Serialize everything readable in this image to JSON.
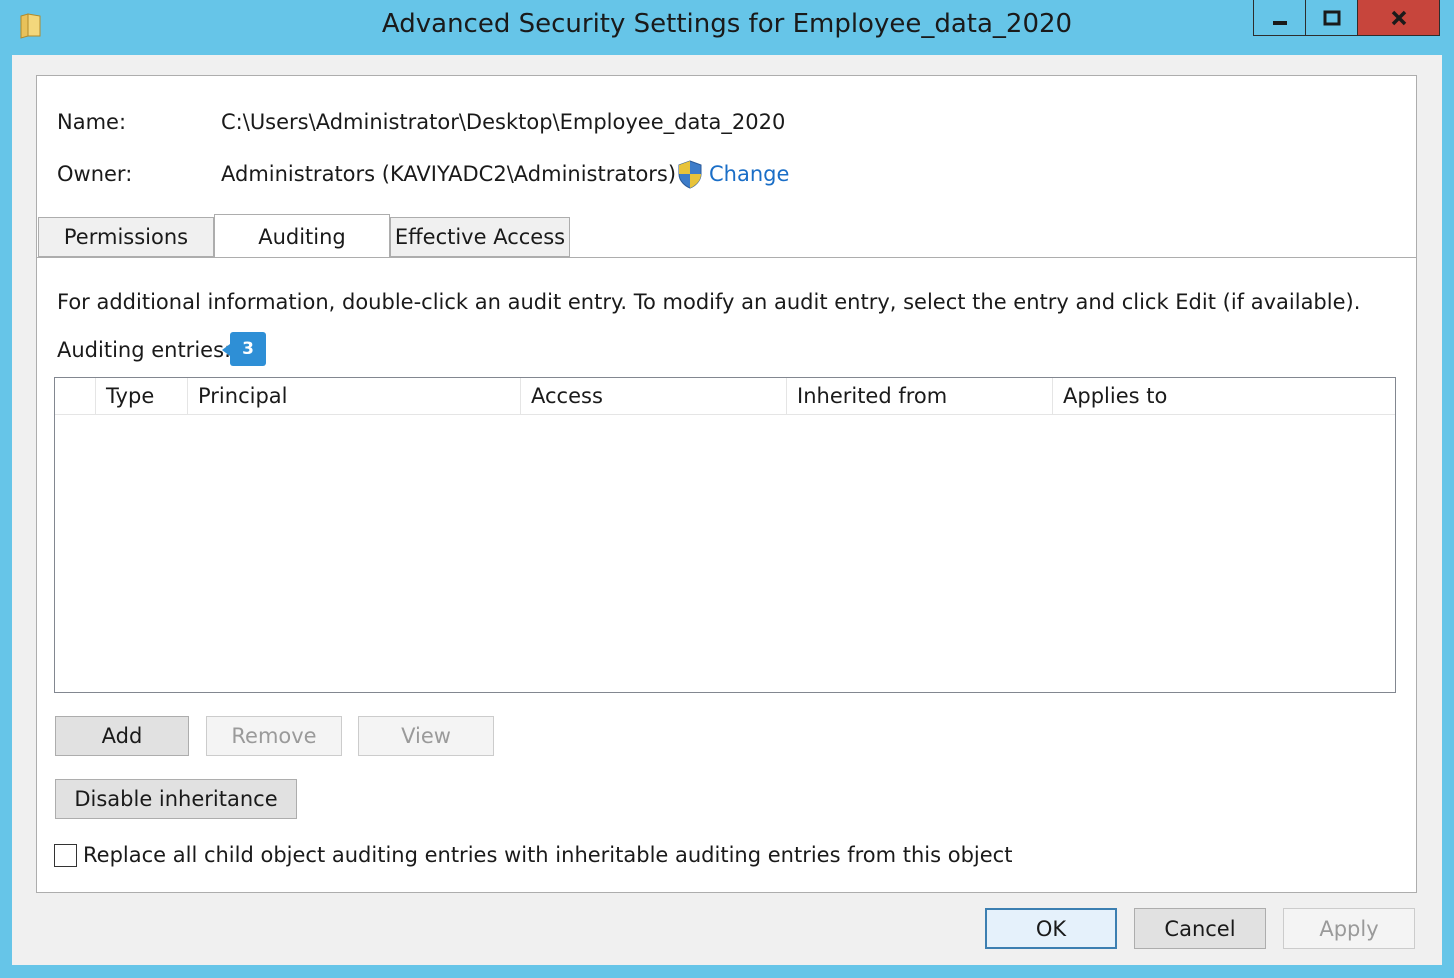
{
  "window": {
    "title": "Advanced Security Settings for Employee_data_2020",
    "minimize_glyph": "▁",
    "maximize_glyph": "□",
    "close_glyph": "✕",
    "accent_color": "#66c5e8",
    "close_color": "#c7453c"
  },
  "info": {
    "name_label": "Name:",
    "name_value": "C:\\Users\\Administrator\\Desktop\\Employee_data_2020",
    "owner_label": "Owner:",
    "owner_value": "Administrators (KAVIYADC2\\Administrators)",
    "change_link": "Change",
    "link_color": "#1a6ec7"
  },
  "tabs": [
    {
      "label": "Permissions",
      "active": false
    },
    {
      "label": "Auditing",
      "active": true
    },
    {
      "label": "Effective Access",
      "active": false
    }
  ],
  "auditing": {
    "instructions": "For additional information, double-click an audit entry. To modify an audit entry, select the entry and click Edit (if available).",
    "entries_label": "Auditing entries:",
    "callout_number": "3",
    "columns": [
      "Type",
      "Principal",
      "Access",
      "Inherited from",
      "Applies to"
    ],
    "rows": []
  },
  "buttons": {
    "add": "Add",
    "remove": "Remove",
    "view": "View",
    "disable_inheritance": "Disable inheritance"
  },
  "checkbox": {
    "label": "Replace all child object auditing entries with inheritable auditing entries from this object",
    "checked": false
  },
  "footer": {
    "ok": "OK",
    "cancel": "Cancel",
    "apply": "Apply"
  }
}
